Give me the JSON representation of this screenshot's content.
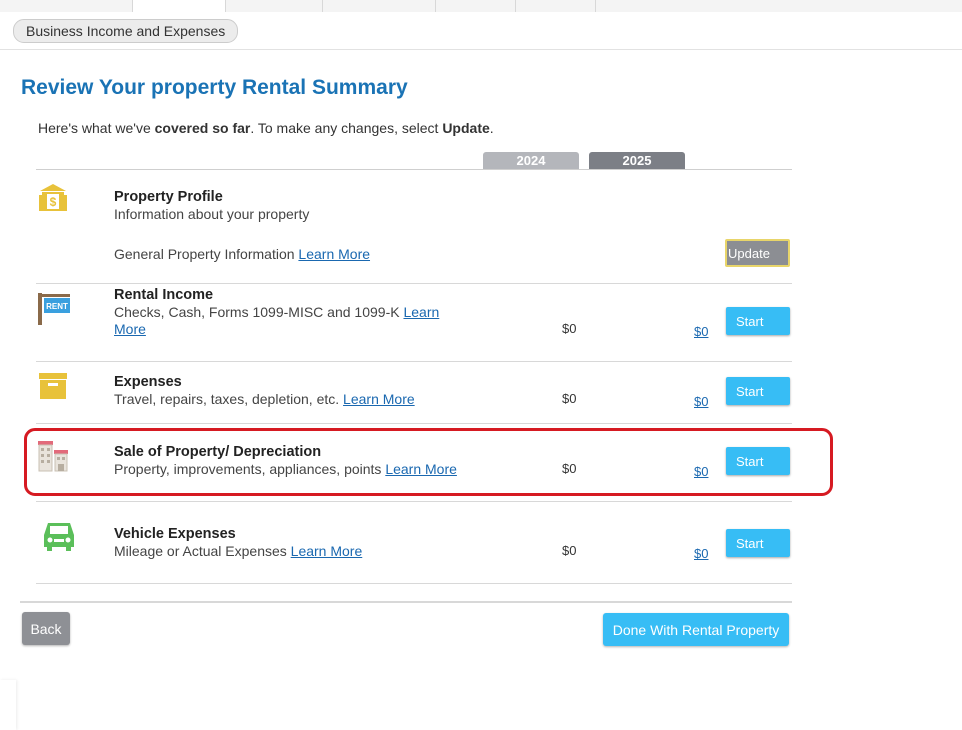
{
  "breadcrumb": "Business Income and Expenses",
  "page_title": "Review Your property Rental Summary",
  "intro": {
    "part1": "Here's what we've ",
    "bold1": "covered so far",
    "part2": ". To make any changes, select ",
    "bold2": "Update",
    "part3": "."
  },
  "years": [
    "2024",
    "2025"
  ],
  "rows": {
    "profile": {
      "title": "Property Profile",
      "desc": "Information about your property",
      "sub_label": "General Property Information",
      "learn_more": "Learn More",
      "button": "Update",
      "icon": "money-building-icon"
    },
    "rental_income": {
      "title": "Rental Income",
      "desc": "Checks, Cash, Forms 1099-MISC and 1099-K",
      "learn_more": "Learn More",
      "amount_2024": "$0",
      "amount_2025": "$0",
      "button": "Start",
      "icon": "rent-sign-icon"
    },
    "expenses": {
      "title": "Expenses",
      "desc": "Travel, repairs, taxes, depletion, etc.",
      "learn_more": "Learn More",
      "amount_2024": "$0",
      "amount_2025": "$0",
      "button": "Start",
      "icon": "archive-box-icon"
    },
    "sale": {
      "title": "Sale of Property/ Depreciation",
      "desc": "Property, improvements, appliances, points",
      "learn_more": "Learn More",
      "amount_2024": "$0",
      "amount_2025": "$0",
      "button": "Start",
      "icon": "buildings-icon"
    },
    "vehicle": {
      "title": "Vehicle Expenses",
      "desc": "Mileage or Actual Expenses",
      "learn_more": "Learn More",
      "amount_2024": "$0",
      "amount_2025": "$0",
      "button": "Start",
      "icon": "car-icon"
    }
  },
  "footer": {
    "back": "Back",
    "done": "Done With Rental Property"
  },
  "colors": {
    "title_blue": "#1a73b5",
    "button_blue": "#37bdf5",
    "button_gray": "#8c8e93",
    "highlight_red": "#d61a22",
    "icon_yellow": "#e8c23a",
    "icon_green": "#5bbf5a"
  }
}
